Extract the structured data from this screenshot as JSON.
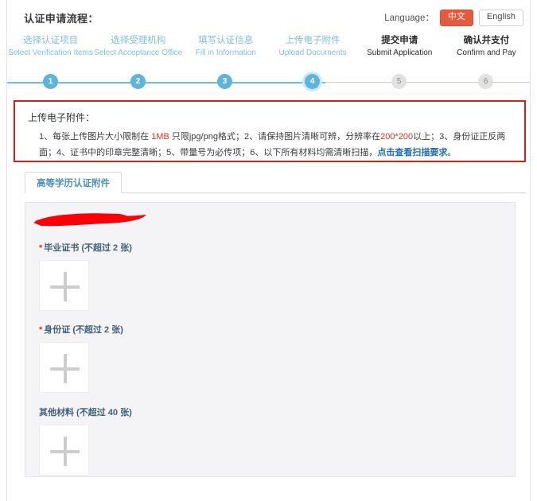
{
  "header": {
    "title": "认证申请流程：",
    "language_label": "Language：",
    "lang_cn": "中文",
    "lang_en": "English"
  },
  "stepper": {
    "steps": [
      {
        "num": "1",
        "cn": "选择认证项目",
        "en": "Select Verification Items",
        "state": "done"
      },
      {
        "num": "2",
        "cn": "选择受理机构",
        "en": "Select Acceptance Office",
        "state": "done"
      },
      {
        "num": "3",
        "cn": "填写认证信息",
        "en": "Fill in Information",
        "state": "done"
      },
      {
        "num": "4",
        "cn": "上传电子附件",
        "en": "Upload Documents",
        "state": "current"
      },
      {
        "num": "5",
        "cn": "提交申请",
        "en": "Submit Application",
        "state": "todo"
      },
      {
        "num": "6",
        "cn": "确认并支付",
        "en": "Confirm and Pay",
        "state": "todo"
      }
    ],
    "colors": {
      "active": "#5fb4dd",
      "inactive": "#e2e2e2",
      "line_done": "#6fbde4",
      "line_todo": "#cfcfcf"
    }
  },
  "notice": {
    "title": "上传电子附件：",
    "border_color": "#e01919",
    "segments": [
      {
        "text": "1、每张上传图片大小限制在 ",
        "style": "normal"
      },
      {
        "text": "1MB",
        "style": "red"
      },
      {
        "text": " 只限jpg/png格式；2、请保持图片清晰可辨，分辨率在",
        "style": "normal"
      },
      {
        "text": "200*200",
        "style": "red"
      },
      {
        "text": "以上；3、身份证正反两面；4、证书中的印章完整清晰；5、带量号为必传项；6、以下所有材料均需清晰扫描，",
        "style": "normal"
      },
      {
        "text": "点击查看扫描要求",
        "style": "link"
      },
      {
        "text": "。",
        "style": "normal"
      }
    ]
  },
  "tabs": {
    "items": [
      {
        "label": "高等学历认证附件",
        "active": true
      }
    ]
  },
  "upload_panel": {
    "fields": [
      {
        "required": true,
        "label": "毕业证书 (不超过 2 张)",
        "max": "2",
        "icon": "plus-icon"
      },
      {
        "required": true,
        "label": "身份证 (不超过 2 张)",
        "max": "2",
        "icon": "plus-icon"
      },
      {
        "required": false,
        "label": "其他材料 (不超过 40 张)",
        "max": "40",
        "icon": "plus-icon"
      }
    ],
    "redaction": {
      "color": "#fb0007",
      "present": true
    }
  }
}
